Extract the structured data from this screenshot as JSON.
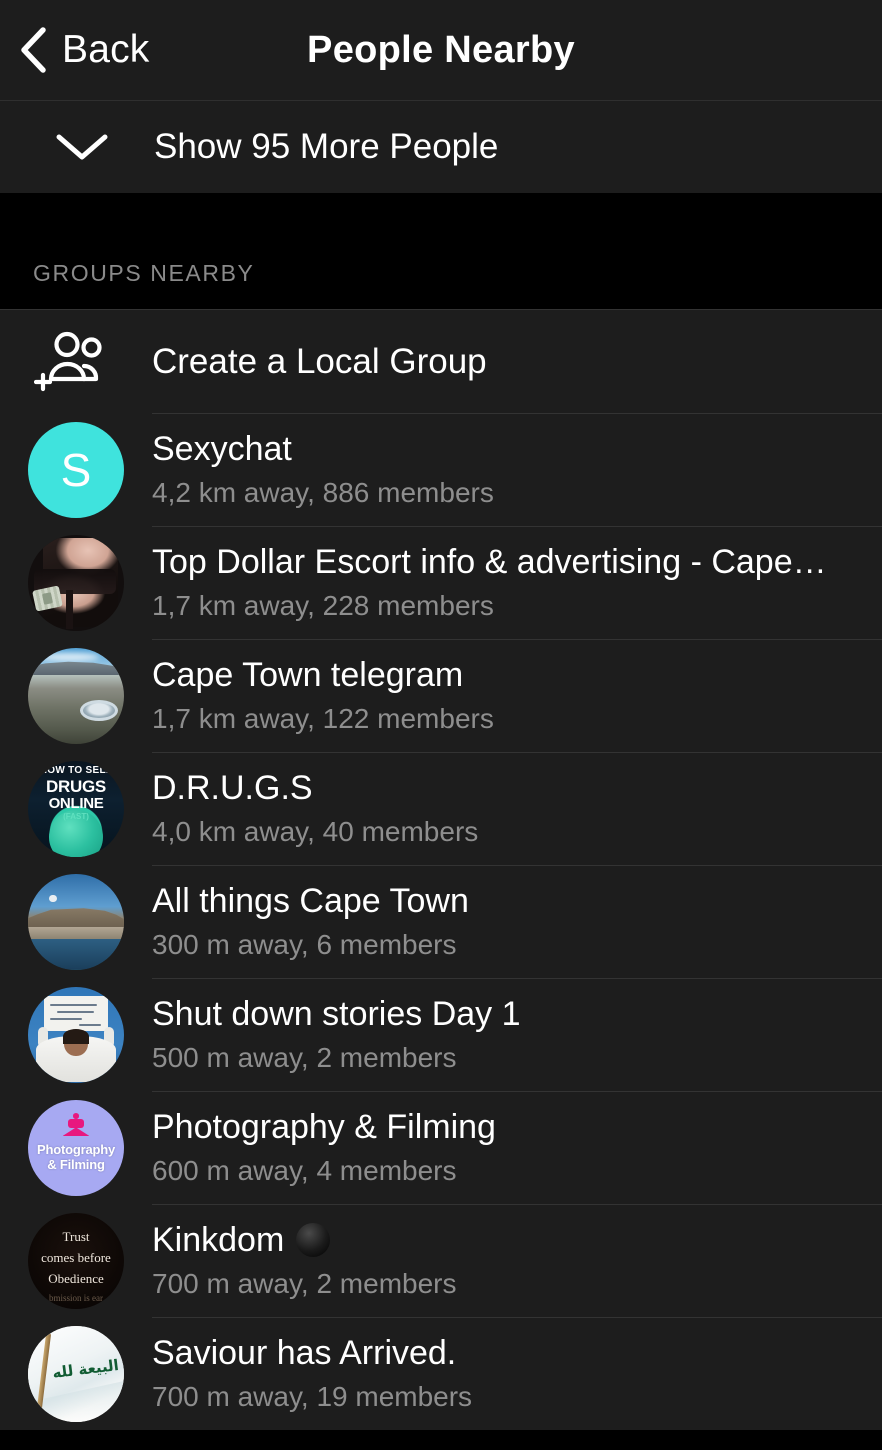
{
  "header": {
    "back_label": "Back",
    "title": "People Nearby",
    "back_icon": "chevron-left-icon"
  },
  "show_more": {
    "label": "Show 95 More People",
    "icon": "chevron-down-icon",
    "count": 95
  },
  "section": {
    "title": "GROUPS NEARBY"
  },
  "create_group": {
    "label": "Create a Local Group",
    "icon": "add-people-icon"
  },
  "groups": [
    {
      "name": "Sexychat",
      "meta": "4,2 km away, 886 members",
      "distance": "4,2 km away",
      "members": "886 members",
      "avatar": "letter",
      "avatar_letter": "S",
      "avatar_color": "#3fe3dd"
    },
    {
      "name": "Top Dollar Escort info & advertising - Cape…",
      "meta": "1,7 km away, 228 members",
      "distance": "1,7 km away",
      "members": "228 members",
      "avatar": "photo-escort"
    },
    {
      "name": "Cape Town telegram",
      "meta": "1,7 km away, 122 members",
      "distance": "1,7 km away",
      "members": "122 members",
      "avatar": "photo-capetown-aerial"
    },
    {
      "name": "D.R.U.G.S",
      "meta": "4,0 km away, 40 members",
      "distance": "4,0 km away",
      "members": "40 members",
      "avatar": "poster-how-to-sell-drugs-online",
      "avatar_text": [
        "HOW TO SELL",
        "DRUGS",
        "ONLINE",
        "(FAST)"
      ]
    },
    {
      "name": "All things Cape Town",
      "meta": "300 m away, 6 members",
      "distance": "300 m away",
      "members": "6 members",
      "avatar": "photo-table-mountain"
    },
    {
      "name": "Shut down stories Day 1",
      "meta": "500 m away, 2 members",
      "distance": "500 m away",
      "members": "2 members",
      "avatar": "photo-protest-sign"
    },
    {
      "name": "Photography & Filming",
      "meta": "600 m away, 4 members",
      "distance": "600 m away",
      "members": "4 members",
      "avatar": "logo-photography-filming",
      "avatar_text": [
        "Photography",
        "& Filming"
      ],
      "avatar_color": "#a7a9f2"
    },
    {
      "name": "Kinkdom",
      "meta": "700 m away, 2 members",
      "distance": "700 m away",
      "members": "2 members",
      "avatar": "quote-trust-obedience",
      "avatar_text": [
        "Trust",
        "comes before",
        "Obedience"
      ],
      "avatar_subtext": "bmission is ear",
      "trailing_emoji": "black-circle"
    },
    {
      "name": "Saviour has Arrived.",
      "meta": "700 m away, 19 members",
      "distance": "700 m away",
      "members": "19 members",
      "avatar": "photo-white-flag-arabic",
      "avatar_text": "البيعة لله"
    }
  ],
  "colors": {
    "background": "#000000",
    "row_background": "#1d1d1d",
    "divider": "#333333",
    "primary_text": "#ffffff",
    "secondary_text": "#8e8e8e",
    "section_text": "#8a8a8a"
  }
}
